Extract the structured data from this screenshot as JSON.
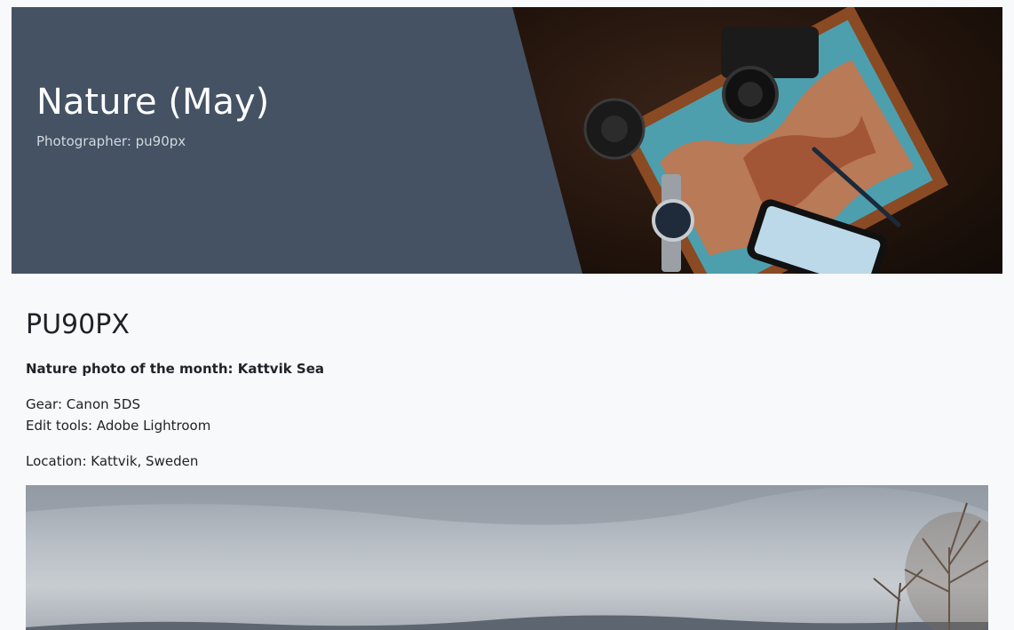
{
  "header": {
    "title": "Nature (May)",
    "subtitle": "Photographer: pu90px",
    "background_color": "#445264"
  },
  "article": {
    "handle": "PU90PX",
    "photo_of_month": "Nature photo of the month: Kattvik Sea",
    "gear": "Gear: Canon 5DS",
    "edit_tools": "Edit tools: Adobe Lightroom",
    "location": "Location: Kattvik, Sweden"
  },
  "colors": {
    "page_background": "#f7f9fb",
    "text": "#1f2328"
  }
}
